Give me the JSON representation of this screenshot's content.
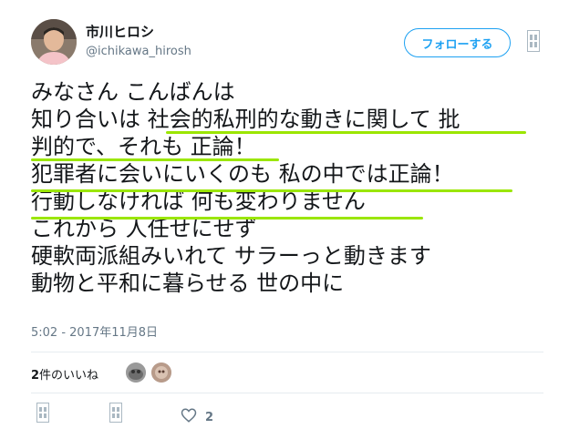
{
  "user": {
    "display_name": "市川ヒロシ",
    "handle": "@ichikawa_hirosh"
  },
  "follow_button": {
    "label": "フォローする"
  },
  "tweet": {
    "lines": [
      "みなさん こんばんは",
      "知り合いは 社会的私刑的な動きに関して 批",
      "判的で、それも 正論！",
      "犯罪者に会いにいくのも 私の中では正論！",
      "行動しなければ 何も変わりません",
      "これから 人任せにせず",
      "硬軟両派組みいれて サラーっと動きます",
      "動物と平和に暮らせる 世の中に"
    ],
    "highlight_color": "#9be600"
  },
  "timestamp": "5:02 - 2017年11月8日",
  "likes": {
    "count": "2",
    "label": "件のいいね"
  },
  "actions": {
    "like_count": "2"
  },
  "colors": {
    "accent": "#1da1f2",
    "secondary_text": "#657786",
    "divider": "#e6ecf0"
  }
}
